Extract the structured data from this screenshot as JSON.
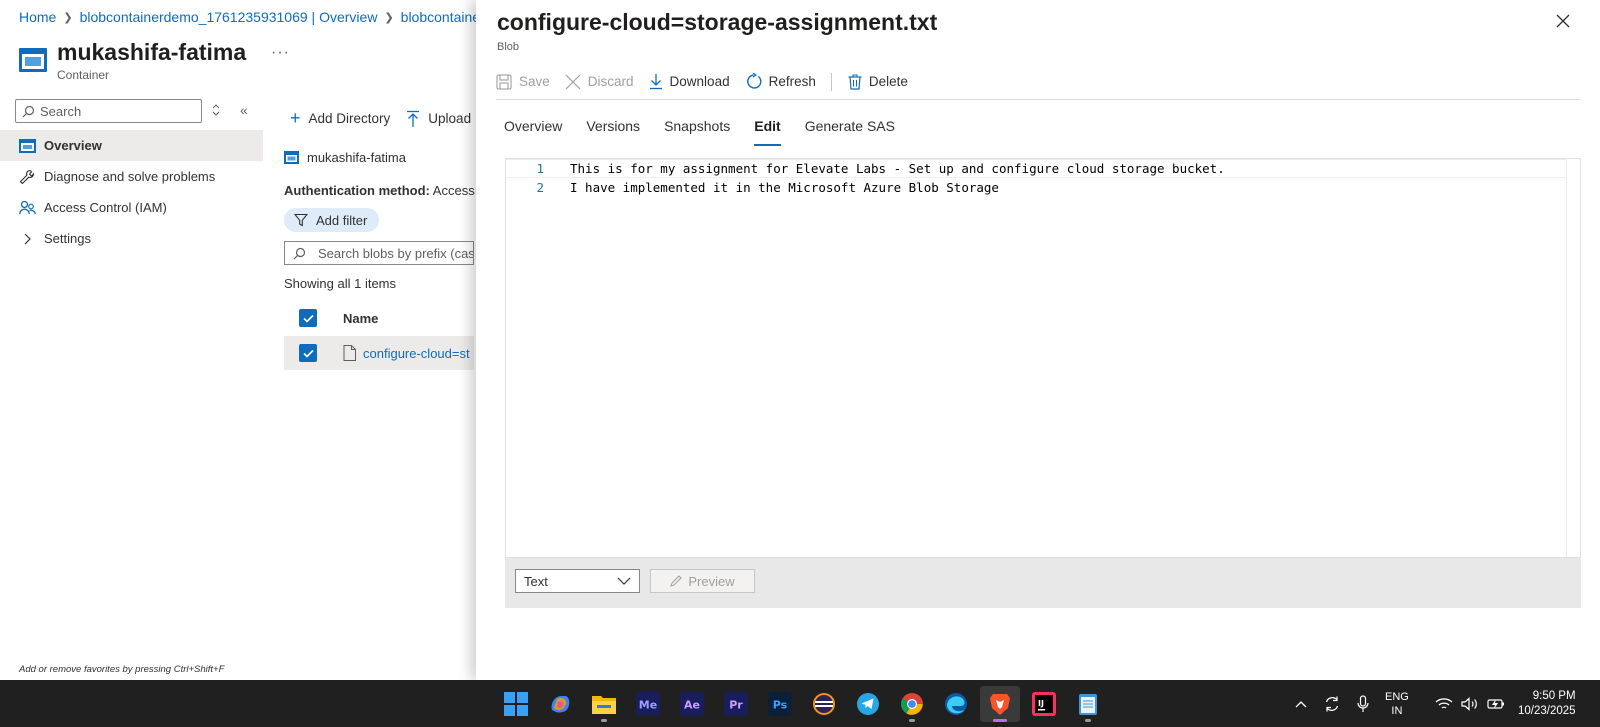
{
  "breadcrumb": [
    "Home",
    "blobcontainerdemo_1761235931069 | Overview",
    "blobcontainer"
  ],
  "resource": {
    "name": "mukashifa-fatima",
    "type": "Container",
    "more": "···"
  },
  "sidebar": {
    "search_placeholder": "Search",
    "items": [
      {
        "label": "Overview",
        "icon": "container-icon",
        "active": true
      },
      {
        "label": "Diagnose and solve problems",
        "icon": "wrench-icon"
      },
      {
        "label": "Access Control (IAM)",
        "icon": "people-icon"
      },
      {
        "label": "Settings",
        "icon": "chevron-right-icon"
      }
    ],
    "favorites_hint": "Add or remove favorites by pressing Ctrl+Shift+F"
  },
  "container": {
    "toolbar": {
      "add_directory": "Add Directory",
      "upload": "Upload"
    },
    "name": "mukashifa-fatima",
    "auth_label": "Authentication method:",
    "auth_value": "Access k",
    "add_filter": "Add filter",
    "search_placeholder": "Search blobs by prefix (case",
    "showing": "Showing all 1 items",
    "column_name": "Name",
    "rows": [
      {
        "name": "configure-cloud=st"
      }
    ]
  },
  "panel": {
    "title": "configure-cloud=storage-assignment.txt",
    "subtitle": "Blob",
    "toolbar": {
      "save": "Save",
      "discard": "Discard",
      "download": "Download",
      "refresh": "Refresh",
      "delete": "Delete"
    },
    "tabs": [
      "Overview",
      "Versions",
      "Snapshots",
      "Edit",
      "Generate SAS"
    ],
    "active_tab": "Edit",
    "editor": {
      "lines": [
        {
          "num": "1",
          "text": "This is for my assignment for Elevate Labs - Set up and configure cloud storage bucket."
        },
        {
          "num": "2",
          "text": "I have implemented it in the Microsoft Azure Blob Storage"
        }
      ]
    },
    "footer": {
      "format": "Text",
      "preview": "Preview"
    }
  },
  "taskbar": {
    "apps": [
      "windows-start",
      "copilot",
      "file-explorer",
      "media-encoder",
      "after-effects",
      "premiere-pro",
      "photoshop",
      "eclipse",
      "telegram",
      "chrome",
      "edge",
      "brave",
      "intellij",
      "notepad"
    ],
    "tray": {
      "lang": "ENG",
      "region": "IN",
      "time": "9:50 PM",
      "date": "10/23/2025"
    },
    "colors": {
      "brand_blue": "#0f6cbd"
    }
  }
}
